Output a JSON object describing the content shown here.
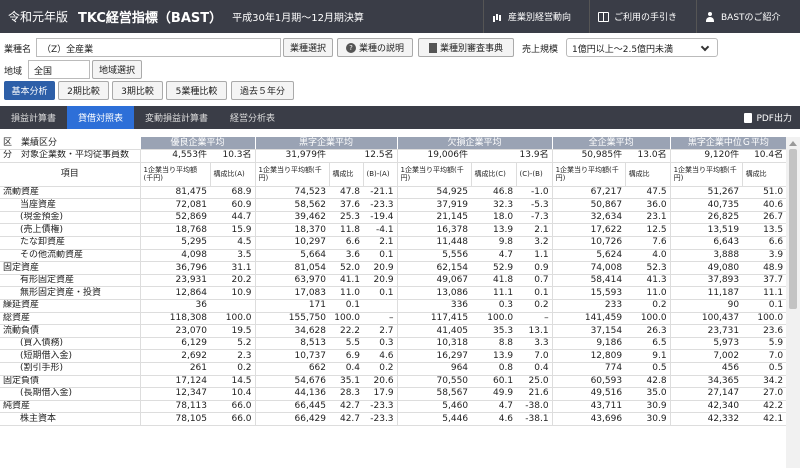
{
  "header": {
    "era": "令和元年版",
    "title": "TKC経営指標（BAST）",
    "period": "平成30年1月期～12月期決算",
    "nav": [
      {
        "label": "産業別経営動向",
        "icon": "bar-chart-icon"
      },
      {
        "label": "ご利用の手引き",
        "icon": "book-icon"
      },
      {
        "label": "BASTのご紹介",
        "icon": "user-icon"
      }
    ]
  },
  "form": {
    "industry_label": "業種名",
    "industry_value": "（Z）全産業",
    "industry_select": "業種選択",
    "industry_desc": "業種の説明",
    "industry_dict": "業種別審査事典",
    "scale_label": "売上規模",
    "scale_value": "1億円以上～2.5億円未満",
    "region_label": "地域",
    "region_value": "全国",
    "region_select": "地域選択"
  },
  "modes": [
    "基本分析",
    "2期比較",
    "3期比較",
    "5業種比較",
    "過去５年分"
  ],
  "tabs": [
    "損益計算書",
    "貸借対照表",
    "変動損益計算書",
    "経営分析表"
  ],
  "pdf_label": "PDF出力",
  "table": {
    "col_kubun": "区",
    "col_gyoseki": "業績区分",
    "col_bun": "分",
    "col_taisho": "対象企業数・平均従事員数",
    "groups": [
      {
        "name": "優良企業平均",
        "count": "4,553件",
        "emp": "10.3名"
      },
      {
        "name": "黒字企業平均",
        "count": "31,979件",
        "emp": "12.5名"
      },
      {
        "name": "欠損企業平均",
        "count": "19,006件",
        "emp": "13.9名"
      },
      {
        "name": "全企業平均",
        "count": "50,985件",
        "emp": "13.0名"
      },
      {
        "name": "黒字企業中位Ｇ平均",
        "count": "9,120件",
        "emp": "10.4名"
      }
    ],
    "item_header": "項目",
    "amt_header": "1企業当り平均額(千円)",
    "ratio_header": "構成比(A)",
    "ratio_b": "構成比",
    "diff_ba": "(B)-(A)",
    "ratio_c": "構成比(C)",
    "diff_cb": "(C)-(B)",
    "ratio_plain": "構成比",
    "rows": [
      {
        "item": "流動資産",
        "v": [
          "81,475",
          "68.9",
          "74,523",
          "47.8",
          "-21.1",
          "54,925",
          "46.8",
          "-1.0",
          "67,217",
          "47.5",
          "51,267",
          "51.0"
        ]
      },
      {
        "item": "当座資産",
        "indent": 1,
        "v": [
          "72,081",
          "60.9",
          "58,562",
          "37.6",
          "-23.3",
          "37,919",
          "32.3",
          "-5.3",
          "50,867",
          "36.0",
          "40,735",
          "40.6"
        ]
      },
      {
        "item": "(現金預金)",
        "indent": 1,
        "v": [
          "52,869",
          "44.7",
          "39,462",
          "25.3",
          "-19.4",
          "21,145",
          "18.0",
          "-7.3",
          "32,634",
          "23.1",
          "26,825",
          "26.7"
        ]
      },
      {
        "item": "(売上債権)",
        "indent": 1,
        "v": [
          "18,768",
          "15.9",
          "18,370",
          "11.8",
          "-4.1",
          "16,378",
          "13.9",
          "2.1",
          "17,622",
          "12.5",
          "13,519",
          "13.5"
        ]
      },
      {
        "item": "たな卸資産",
        "indent": 1,
        "v": [
          "5,295",
          "4.5",
          "10,297",
          "6.6",
          "2.1",
          "11,448",
          "9.8",
          "3.2",
          "10,726",
          "7.6",
          "6,643",
          "6.6"
        ]
      },
      {
        "item": "その他流動資産",
        "indent": 1,
        "v": [
          "4,098",
          "3.5",
          "5,664",
          "3.6",
          "0.1",
          "5,556",
          "4.7",
          "1.1",
          "5,624",
          "4.0",
          "3,888",
          "3.9"
        ]
      },
      {
        "item": "固定資産",
        "v": [
          "36,796",
          "31.1",
          "81,054",
          "52.0",
          "20.9",
          "62,154",
          "52.9",
          "0.9",
          "74,008",
          "52.3",
          "49,080",
          "48.9"
        ]
      },
      {
        "item": "有形固定資産",
        "indent": 1,
        "v": [
          "23,931",
          "20.2",
          "63,970",
          "41.1",
          "20.9",
          "49,067",
          "41.8",
          "0.7",
          "58,414",
          "41.3",
          "37,893",
          "37.7"
        ]
      },
      {
        "item": "無形固定資産・投資",
        "indent": 1,
        "v": [
          "12,864",
          "10.9",
          "17,083",
          "11.0",
          "0.1",
          "13,086",
          "11.1",
          "0.1",
          "15,593",
          "11.0",
          "11,187",
          "11.1"
        ]
      },
      {
        "item": "繰延資産",
        "v": [
          "36",
          "",
          "171",
          "0.1",
          "",
          "336",
          "0.3",
          "0.2",
          "233",
          "0.2",
          "90",
          "0.1"
        ]
      },
      {
        "item": "総資産",
        "v": [
          "118,308",
          "100.0",
          "155,750",
          "100.0",
          "–",
          "117,415",
          "100.0",
          "–",
          "141,459",
          "100.0",
          "100,437",
          "100.0"
        ]
      },
      {
        "item": "流動負債",
        "v": [
          "23,070",
          "19.5",
          "34,628",
          "22.2",
          "2.7",
          "41,405",
          "35.3",
          "13.1",
          "37,154",
          "26.3",
          "23,731",
          "23.6"
        ]
      },
      {
        "item": "(買入債務)",
        "indent": 1,
        "v": [
          "6,129",
          "5.2",
          "8,513",
          "5.5",
          "0.3",
          "10,318",
          "8.8",
          "3.3",
          "9,186",
          "6.5",
          "5,973",
          "5.9"
        ]
      },
      {
        "item": "(短期借入金)",
        "indent": 1,
        "v": [
          "2,692",
          "2.3",
          "10,737",
          "6.9",
          "4.6",
          "16,297",
          "13.9",
          "7.0",
          "12,809",
          "9.1",
          "7,002",
          "7.0"
        ]
      },
      {
        "item": "(割引手形)",
        "indent": 1,
        "v": [
          "261",
          "0.2",
          "662",
          "0.4",
          "0.2",
          "964",
          "0.8",
          "0.4",
          "774",
          "0.5",
          "456",
          "0.5"
        ]
      },
      {
        "item": "固定負債",
        "v": [
          "17,124",
          "14.5",
          "54,676",
          "35.1",
          "20.6",
          "70,550",
          "60.1",
          "25.0",
          "60,593",
          "42.8",
          "34,365",
          "34.2"
        ]
      },
      {
        "item": "(長期借入金)",
        "indent": 1,
        "v": [
          "12,347",
          "10.4",
          "44,136",
          "28.3",
          "17.9",
          "58,567",
          "49.9",
          "21.6",
          "49,516",
          "35.0",
          "27,147",
          "27.0"
        ]
      },
      {
        "item": "純資産",
        "v": [
          "78,113",
          "66.0",
          "66,445",
          "42.7",
          "-23.3",
          "5,460",
          "4.7",
          "-38.0",
          "43,711",
          "30.9",
          "42,340",
          "42.2"
        ]
      },
      {
        "item": "株主資本",
        "indent": 1,
        "v": [
          "78,105",
          "66.0",
          "66,429",
          "42.7",
          "-23.3",
          "5,446",
          "4.6",
          "-38.1",
          "43,696",
          "30.9",
          "42,332",
          "42.1"
        ]
      }
    ]
  }
}
